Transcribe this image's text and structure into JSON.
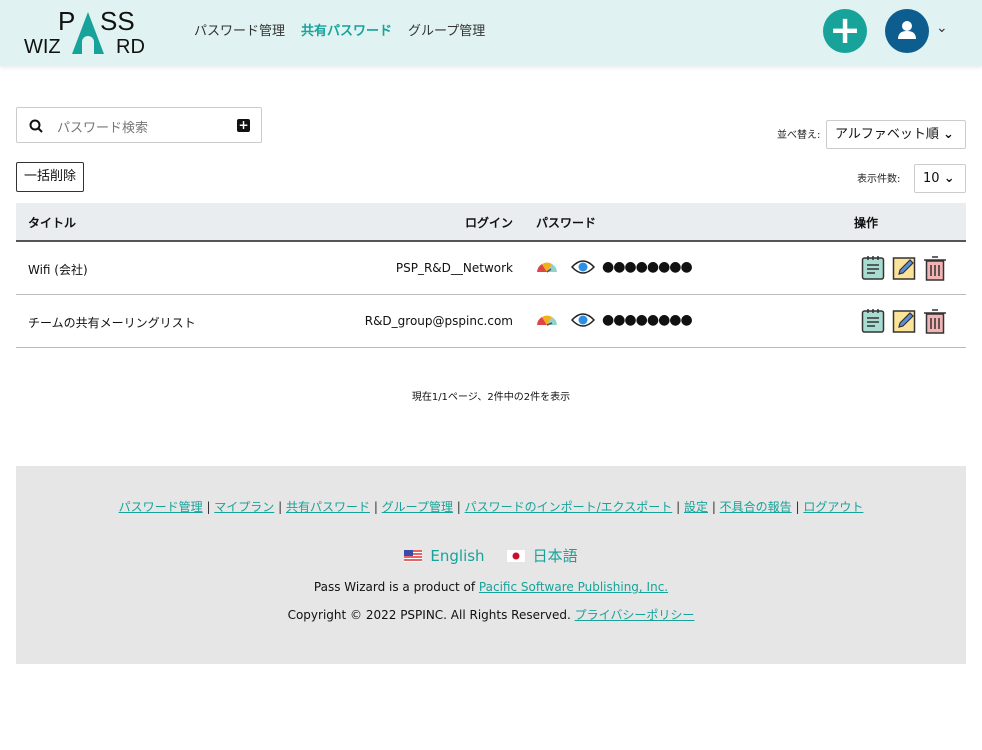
{
  "header": {
    "logo_text": "PASS WIZARD",
    "nav": [
      "パスワード管理",
      "共有パスワード",
      "グループ管理"
    ],
    "active_nav": 1
  },
  "toolbar": {
    "search_placeholder": "パスワード検索",
    "bulk_delete": "一括削除",
    "sort_label": "並べ替え:",
    "sort_value": "アルファベット順",
    "count_label": "表示件数:",
    "count_value": "10"
  },
  "table": {
    "headers": {
      "title": "タイトル",
      "login": "ログイン",
      "password": "パスワード",
      "actions": "操作"
    },
    "rows": [
      {
        "title": "Wifi (会社)",
        "login": "PSP_R&D__Network",
        "password": "●●●●●●●●"
      },
      {
        "title": "チームの共有メーリングリスト",
        "login": "R&D_group@pspinc.com",
        "password": "●●●●●●●●"
      }
    ]
  },
  "pager": "現在1/1ページ、2件中の2件を表示",
  "footer": {
    "links": [
      "パスワード管理",
      "マイプラン",
      "共有パスワード",
      "グループ管理",
      "パスワードのインポート/エクスポート",
      "設定",
      "不具合の報告",
      "ログアウト"
    ],
    "lang_en": "English",
    "lang_ja": "日本語",
    "product_prefix": "Pass Wizard is a product of ",
    "company": "Pacific Software Publishing, Inc.",
    "copyright": "Copyright © 2022 PSPINC. All Rights Reserved. ",
    "privacy": "プライバシーポリシー"
  },
  "colors": {
    "accent": "#17a399",
    "header_bg": "#e0f3f2",
    "avatar": "#0d5d8f"
  }
}
